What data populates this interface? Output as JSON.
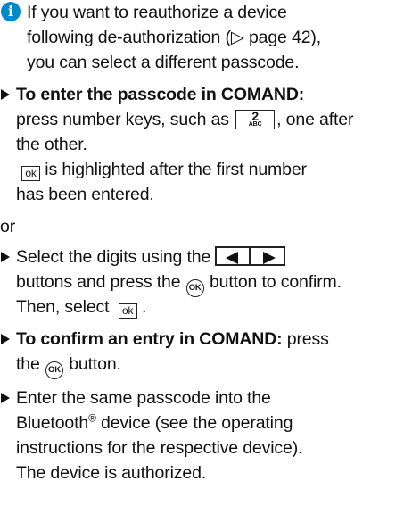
{
  "note": {
    "icon": "info-icon",
    "line1": "If you want to reauthorize a device",
    "line2": "following de-authorization (▷ page 42),",
    "line3": "you can select a different passcode."
  },
  "step1": {
    "bold_label": "To enter the passcode in COMAND:",
    "line2_before": "press number keys, such as ",
    "key_digit": "2",
    "key_letters": "ABC",
    "line2_after": ", one after",
    "line3": "the other.",
    "ok_key": "ok",
    "line4_after": " is highlighted after the first number",
    "line5": "has been entered."
  },
  "or_label": "or",
  "step2": {
    "line1_before": "Select the digits using the ",
    "line2_before": "buttons and press the ",
    "ok_button": "OK",
    "line2_after": " button to confirm.",
    "line3_before": "Then, select ",
    "ok_key": "ok",
    "line3_after": " ."
  },
  "step3": {
    "bold_label": "To confirm an entry in COMAND:",
    "line1_after": " press",
    "line2_before": "the ",
    "ok_button": "OK",
    "line2_after": " button."
  },
  "step4": {
    "line1": "Enter the same passcode into the",
    "line2_before": "Bluetooth",
    "registered": "®",
    "line2_after": " device (see the operating",
    "line3": "instructions for the respective device).",
    "line4": "The device is authorized."
  },
  "colors": {
    "info_icon": "#0089c8",
    "text": "#111111"
  }
}
